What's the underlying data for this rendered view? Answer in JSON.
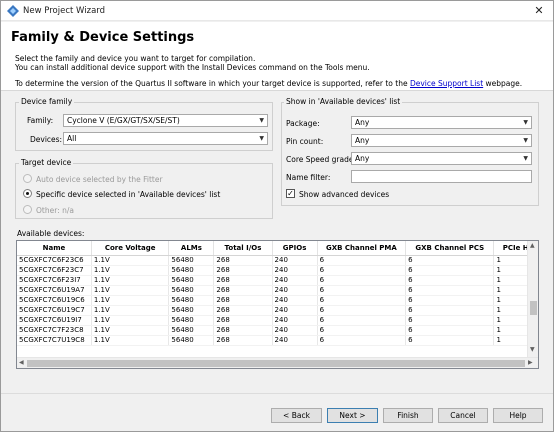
{
  "window": {
    "title": "New Project Wizard",
    "close_glyph": "✕",
    "icon": "quartus-app-icon"
  },
  "header": {
    "title": "Family & Device Settings",
    "line1": "Select the family and device you want to target for compilation.",
    "line2": "You can install additional device support with the Install Devices command on the Tools menu.",
    "line3_prefix": "To determine the version of the Quartus II software in which your target device is supported, refer to the ",
    "line3_link": "Device Support List",
    "line3_suffix": " webpage."
  },
  "device_family": {
    "group_label": "Device family",
    "family_label": "Family:",
    "family_value": "Cyclone V (E/GX/GT/SX/SE/ST)",
    "devices_label": "Devices:",
    "devices_value": "All"
  },
  "target_device": {
    "group_label": "Target device",
    "option_auto": "Auto device selected by the Fitter",
    "option_specific": "Specific device selected in 'Available devices' list",
    "option_other": "Other:  n/a",
    "selected": "specific"
  },
  "show_filters": {
    "group_label": "Show in 'Available devices' list",
    "package_label": "Package:",
    "package_value": "Any",
    "pin_count_label": "Pin count:",
    "pin_count_value": "Any",
    "speed_label": "Core Speed grade:",
    "speed_value": "Any",
    "name_filter_label": "Name filter:",
    "name_filter_value": "",
    "advanced_label": "Show advanced devices",
    "advanced_checked": true
  },
  "available_devices": {
    "label": "Available devices:",
    "columns": [
      "Name",
      "Core Voltage",
      "ALMs",
      "Total I/Os",
      "GPIOs",
      "GXB Channel PMA",
      "GXB Channel PCS",
      "PCIe H"
    ],
    "rows": [
      [
        "5CGXFC7C6F23C6",
        "1.1V",
        "56480",
        "268",
        "240",
        "6",
        "6",
        "1"
      ],
      [
        "5CGXFC7C6F23C7",
        "1.1V",
        "56480",
        "268",
        "240",
        "6",
        "6",
        "1"
      ],
      [
        "5CGXFC7C6F23I7",
        "1.1V",
        "56480",
        "268",
        "240",
        "6",
        "6",
        "1"
      ],
      [
        "5CGXFC7C6U19A7",
        "1.1V",
        "56480",
        "268",
        "240",
        "6",
        "6",
        "1"
      ],
      [
        "5CGXFC7C6U19C6",
        "1.1V",
        "56480",
        "268",
        "240",
        "6",
        "6",
        "1"
      ],
      [
        "5CGXFC7C6U19C7",
        "1.1V",
        "56480",
        "268",
        "240",
        "6",
        "6",
        "1"
      ],
      [
        "5CGXFC7C6U19I7",
        "1.1V",
        "56480",
        "268",
        "240",
        "6",
        "6",
        "1"
      ],
      [
        "5CGXFC7C7F23C8",
        "1.1V",
        "56480",
        "268",
        "240",
        "6",
        "6",
        "1"
      ],
      [
        "5CGXFC7C7U19C8",
        "1.1V",
        "56480",
        "268",
        "240",
        "6",
        "6",
        "1"
      ]
    ]
  },
  "buttons": {
    "back": "< Back",
    "next": "Next >",
    "finish": "Finish",
    "cancel": "Cancel",
    "help": "Help"
  }
}
